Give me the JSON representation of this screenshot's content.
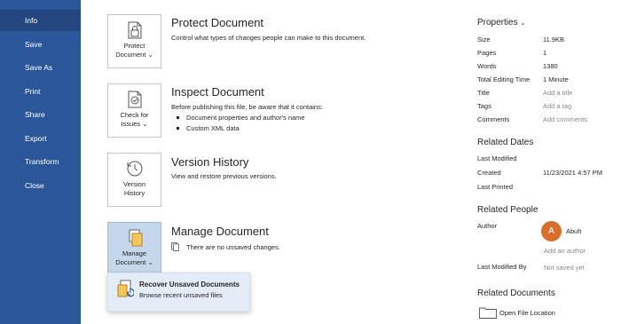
{
  "nav": {
    "items": [
      {
        "label": "Info",
        "active": true
      },
      {
        "label": "Save"
      },
      {
        "label": "Save As"
      },
      {
        "label": "Print"
      },
      {
        "label": "Share"
      },
      {
        "label": "Export"
      },
      {
        "label": "Transform"
      },
      {
        "label": "Close"
      }
    ]
  },
  "sections": {
    "protect": {
      "tile_line1": "Protect",
      "tile_line2": "Document",
      "title": "Protect Document",
      "desc": "Control what types of changes people can make to this document."
    },
    "inspect": {
      "tile_line1": "Check for",
      "tile_line2": "Issues",
      "title": "Inspect Document",
      "desc": "Before publishing this file, be aware that it contains:",
      "bullets": [
        "Document properties and author's name",
        "Custom XML data"
      ]
    },
    "version": {
      "tile_line1": "Version",
      "tile_line2": "History",
      "title": "Version History",
      "desc": "View and restore previous versions."
    },
    "manage": {
      "tile_line1": "Manage",
      "tile_line2": "Document",
      "title": "Manage Document",
      "desc": "There are no unsaved changes."
    }
  },
  "popup": {
    "title": "Recover Unsaved Documents",
    "desc": "Browse recent unsaved files"
  },
  "properties": {
    "heading": "Properties",
    "rows": [
      {
        "label": "Size",
        "value": "11.9KB"
      },
      {
        "label": "Pages",
        "value": "1"
      },
      {
        "label": "Words",
        "value": "1380"
      },
      {
        "label": "Total Editing Time",
        "value": "1 Minute"
      },
      {
        "label": "Title",
        "value": "Add a title"
      },
      {
        "label": "Tags",
        "value": "Add a tag"
      },
      {
        "label": "Comments",
        "value": "Add comments"
      }
    ]
  },
  "related_dates": {
    "heading": "Related Dates",
    "rows": [
      {
        "label": "Last Modified",
        "value": ""
      },
      {
        "label": "Created",
        "value": "11/23/2021 4:57 PM"
      },
      {
        "label": "Last Printed",
        "value": ""
      }
    ]
  },
  "related_people": {
    "heading": "Related People",
    "author_label": "Author",
    "author_initial": "A",
    "author_name": "Abuh",
    "add_author": "Add an author",
    "last_modified_by_label": "Last Modified By",
    "last_modified_by_value": "Not saved yet"
  },
  "related_documents": {
    "heading": "Related Documents",
    "open_file_location": "Open File Location"
  },
  "colors": {
    "nav_bg": "#2b579a",
    "selected_tile": "#c5d7ea",
    "avatar": "#d86e2c"
  }
}
